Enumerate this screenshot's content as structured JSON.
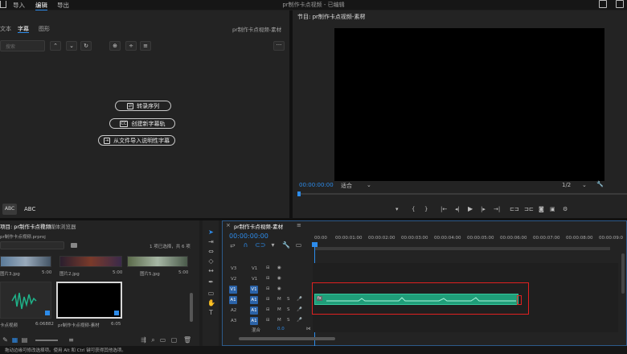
{
  "menu": {
    "home": "",
    "import": "导入",
    "edit": "编辑",
    "export": "导出",
    "title": "pr制作卡点视频 - 已编辑"
  },
  "essential_graphics": {
    "tabs": {
      "text": "文本",
      "captions": "字幕",
      "graphics": "图形"
    },
    "source_name": "pr制作卡点视频-素材",
    "search_placeholder": "搜索",
    "buttons": {
      "convert": "转录序列",
      "create_track": "创建新字幕轨",
      "import_file": "从文件导入说明性字幕"
    },
    "bottom": {
      "abc1": "ABC",
      "abc2": "ABC"
    }
  },
  "program": {
    "title": "节目: pr制作卡点视频-素材",
    "timecode": "00:00:00:00",
    "fit": "适合",
    "res": "1/2"
  },
  "project": {
    "tabs": {
      "project": "项目: pr制作卡点视频",
      "media_browser": "媒体浏览器"
    },
    "file": "pr制作卡点视频.prproj",
    "selection": "1 项已选择，共 6 项",
    "items": [
      {
        "name": "图片3.jpg",
        "dur": "5:00"
      },
      {
        "name": "图片2.jpg",
        "dur": "5:00"
      },
      {
        "name": "图片5.jpg",
        "dur": "5:00"
      },
      {
        "name": "图片4.jpg",
        "dur": "5:00"
      },
      {
        "name": "pr制作卡点视频-素材",
        "dur": "6:05"
      }
    ],
    "audio_name": "卡点视频",
    "audio_dur": "6:06882"
  },
  "timeline": {
    "tab": "pr制作卡点视频-素材",
    "timecode": "00:00:00:00",
    "ruler": [
      "00:00",
      "00:00:01:00",
      "00:00:02:00",
      "00:00:03:00",
      "00:00:04:00",
      "00:00:05:00",
      "00:00:06:00",
      "00:00:07:00",
      "00:00:08:00",
      "00:00:09:0"
    ],
    "tracks": [
      {
        "name": "V3",
        "tgt": "V1"
      },
      {
        "name": "V2",
        "tgt": "V1"
      },
      {
        "name": "V1",
        "tgt": "V1"
      },
      {
        "name": "A1",
        "tgt": "A1"
      },
      {
        "name": "A2",
        "tgt": "A1"
      },
      {
        "name": "A3",
        "tgt": "A1"
      }
    ],
    "mix": "混合",
    "mix_val": "0.0",
    "clip_label": "fx"
  },
  "status": "拖动边缘可修改选择项。使用 Alt 和 Ctrl 键可获得其他选项。",
  "colors": {
    "accent": "#2d8ceb",
    "clip": "#1f9e79",
    "highlight": "#e02020"
  }
}
